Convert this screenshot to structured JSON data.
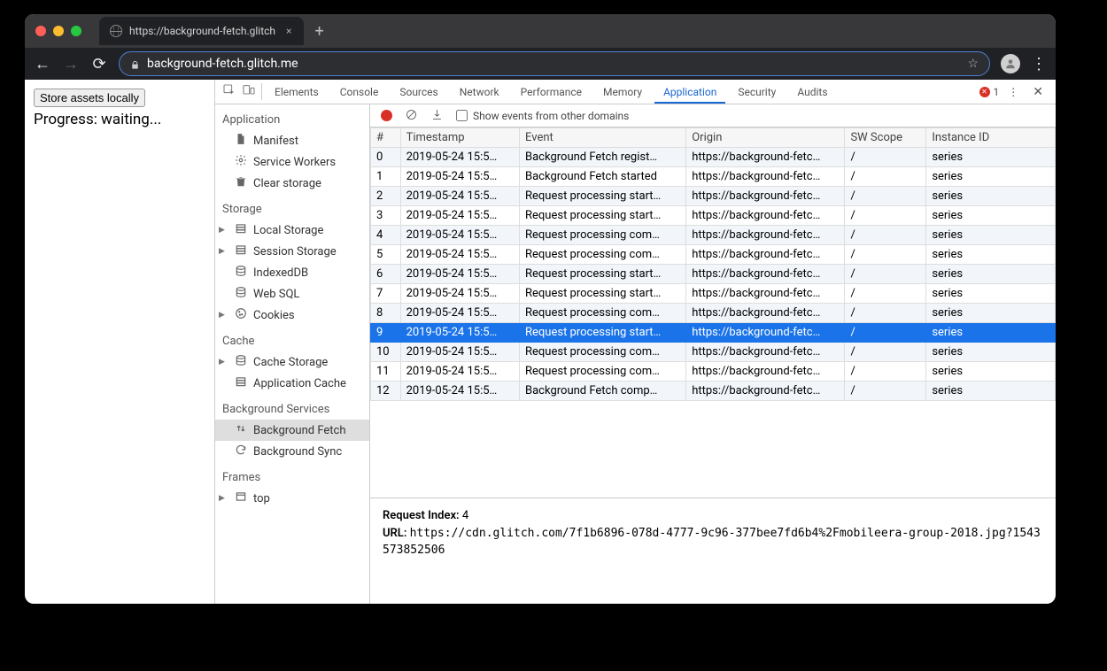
{
  "browser": {
    "tab_title": "https://background-fetch.glitch",
    "url_display": "background-fetch.glitch.me"
  },
  "page": {
    "button": "Store assets locally",
    "progress": "Progress: waiting..."
  },
  "devtools": {
    "tabs": [
      "Elements",
      "Console",
      "Sources",
      "Network",
      "Performance",
      "Memory",
      "Application",
      "Security",
      "Audits"
    ],
    "active_tab": "Application",
    "error_count": "1",
    "sidebar": {
      "sections": [
        {
          "title": "Application",
          "items": [
            {
              "label": "Manifest",
              "icon": "file"
            },
            {
              "label": "Service Workers",
              "icon": "gear"
            },
            {
              "label": "Clear storage",
              "icon": "trash"
            }
          ]
        },
        {
          "title": "Storage",
          "items": [
            {
              "label": "Local Storage",
              "icon": "db",
              "expandable": true
            },
            {
              "label": "Session Storage",
              "icon": "db",
              "expandable": true
            },
            {
              "label": "IndexedDB",
              "icon": "stack"
            },
            {
              "label": "Web SQL",
              "icon": "stack"
            },
            {
              "label": "Cookies",
              "icon": "cookie",
              "expandable": true
            }
          ]
        },
        {
          "title": "Cache",
          "items": [
            {
              "label": "Cache Storage",
              "icon": "stack",
              "expandable": true
            },
            {
              "label": "Application Cache",
              "icon": "db"
            }
          ]
        },
        {
          "title": "Background Services",
          "items": [
            {
              "label": "Background Fetch",
              "icon": "updown",
              "selected": true
            },
            {
              "label": "Background Sync",
              "icon": "sync"
            }
          ]
        },
        {
          "title": "Frames",
          "items": [
            {
              "label": "top",
              "icon": "frame",
              "expandable": true
            }
          ]
        }
      ]
    },
    "actionbar": {
      "show_other_label": "Show events from other domains"
    },
    "table": {
      "columns": [
        "#",
        "Timestamp",
        "Event",
        "Origin",
        "SW Scope",
        "Instance ID"
      ],
      "rows": [
        {
          "n": "0",
          "ts": "2019-05-24 15:5…",
          "ev": "Background Fetch regist…",
          "or": "https://background-fetc…",
          "sw": "/",
          "iid": "series"
        },
        {
          "n": "1",
          "ts": "2019-05-24 15:5…",
          "ev": "Background Fetch started",
          "or": "https://background-fetc…",
          "sw": "/",
          "iid": "series"
        },
        {
          "n": "2",
          "ts": "2019-05-24 15:5…",
          "ev": "Request processing start…",
          "or": "https://background-fetc…",
          "sw": "/",
          "iid": "series"
        },
        {
          "n": "3",
          "ts": "2019-05-24 15:5…",
          "ev": "Request processing start…",
          "or": "https://background-fetc…",
          "sw": "/",
          "iid": "series"
        },
        {
          "n": "4",
          "ts": "2019-05-24 15:5…",
          "ev": "Request processing com…",
          "or": "https://background-fetc…",
          "sw": "/",
          "iid": "series"
        },
        {
          "n": "5",
          "ts": "2019-05-24 15:5…",
          "ev": "Request processing com…",
          "or": "https://background-fetc…",
          "sw": "/",
          "iid": "series"
        },
        {
          "n": "6",
          "ts": "2019-05-24 15:5…",
          "ev": "Request processing start…",
          "or": "https://background-fetc…",
          "sw": "/",
          "iid": "series"
        },
        {
          "n": "7",
          "ts": "2019-05-24 15:5…",
          "ev": "Request processing start…",
          "or": "https://background-fetc…",
          "sw": "/",
          "iid": "series"
        },
        {
          "n": "8",
          "ts": "2019-05-24 15:5…",
          "ev": "Request processing com…",
          "or": "https://background-fetc…",
          "sw": "/",
          "iid": "series"
        },
        {
          "n": "9",
          "ts": "2019-05-24 15:5…",
          "ev": "Request processing start…",
          "or": "https://background-fetc…",
          "sw": "/",
          "iid": "series",
          "selected": true
        },
        {
          "n": "10",
          "ts": "2019-05-24 15:5…",
          "ev": "Request processing com…",
          "or": "https://background-fetc…",
          "sw": "/",
          "iid": "series"
        },
        {
          "n": "11",
          "ts": "2019-05-24 15:5…",
          "ev": "Request processing com…",
          "or": "https://background-fetc…",
          "sw": "/",
          "iid": "series"
        },
        {
          "n": "12",
          "ts": "2019-05-24 15:5…",
          "ev": "Background Fetch comp…",
          "or": "https://background-fetc…",
          "sw": "/",
          "iid": "series"
        }
      ]
    },
    "detail": {
      "request_index_label": "Request Index:",
      "request_index": "4",
      "url_label": "URL:",
      "url": "https://cdn.glitch.com/7f1b6896-078d-4777-9c96-377bee7fd6b4%2Fmobileera-group-2018.jpg?1543573852506"
    }
  }
}
